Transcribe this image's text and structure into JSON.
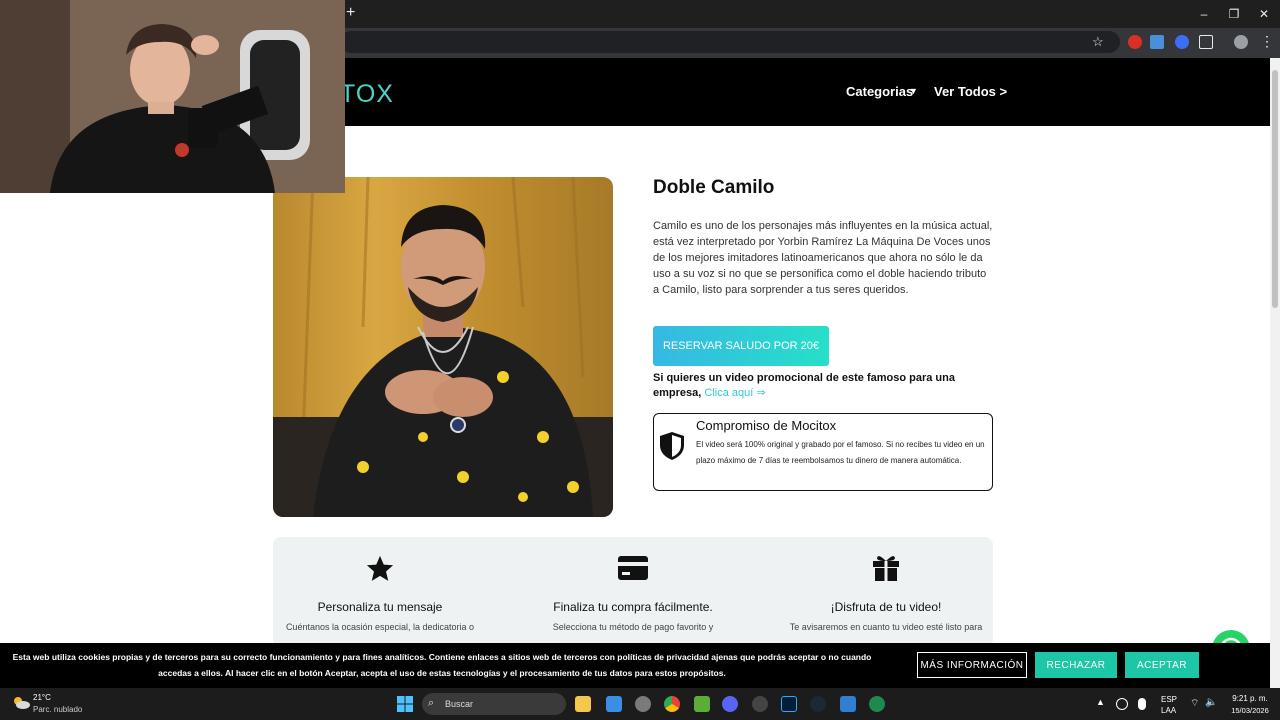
{
  "browser": {
    "new_tab_symbol": "+",
    "minimize_symbol": "–",
    "maximize_symbol": "❐",
    "close_symbol": "✕"
  },
  "site": {
    "logo_text": "TOX",
    "nav": {
      "categories_label": "Categorias",
      "view_all_label": "Ver Todos >"
    },
    "accent_color": "#4fd1c5"
  },
  "product": {
    "title": "Doble Camilo",
    "description": "Camilo es uno de los personajes más influyentes en la música actual, está vez interpretado por Yorbin Ramírez La Máquina De Voces unos de los mejores imitadores latinoamericanos que ahora no sólo le da uso a su voz si no que se personifica como el doble haciendo tributo a Camilo, listo para sorprender a tus seres queridos.",
    "cta_label": "RESERVAR SALUDO POR 20€",
    "promo_text": "Si quieres un video promocional de este famoso para una empresa,",
    "promo_link": "Clica aquí ⇒",
    "guarantee": {
      "title": "Compromiso de Mocitox",
      "text": "El video será 100% original y grabado por el famoso. Si no recibes tu video en un plazo máximo de 7 días te reembolsamos tu dinero de manera automática."
    }
  },
  "features": [
    {
      "icon": "star-icon",
      "title": "Personaliza tu mensaje",
      "text": "Cuéntanos la ocasión especial, la dedicatoria o"
    },
    {
      "icon": "credit-card-icon",
      "title": "Finaliza tu compra fácilmente.",
      "text": "Selecciona tu método de pago favorito y"
    },
    {
      "icon": "gift-icon",
      "title": "¡Disfruta de tu video!",
      "text": "Te avisaremos en cuanto tu video esté listo para"
    }
  ],
  "cookie": {
    "text": "Esta web utiliza cookies propias y de terceros para su correcto funcionamiento y para fines analíticos. Contiene enlaces a sitios web de terceros con políticas de privacidad ajenas que podrás aceptar o no cuando accedas a ellos. Al hacer clic en el botón Aceptar, acepta el uso de estas tecnologías y el procesamiento de tus datos para estos propósitos.",
    "more_label": "MÁS INFORMACIÓN",
    "reject_label": "RECHAZAR",
    "accept_label": "ACEPTAR"
  },
  "taskbar": {
    "weather_temp": "21°C",
    "weather_desc": "Parc. nublado",
    "search_placeholder": "Buscar",
    "lang_line1": "ESP",
    "lang_line2": "LAA",
    "time": "9:21 p. m.",
    "date": "15/03/2026"
  }
}
